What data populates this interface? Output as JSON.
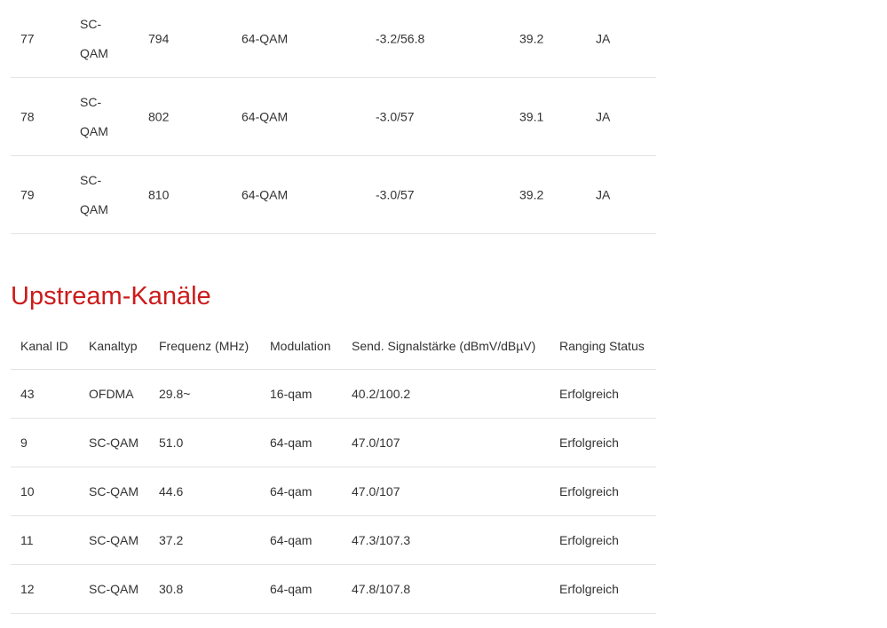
{
  "downstream": {
    "rows": [
      {
        "id": "77",
        "type_line1": "SC-",
        "type_line2": "QAM",
        "freq": "794",
        "modulation": "64-QAM",
        "power": "-3.2/56.8",
        "snr": "39.2",
        "locked": "JA"
      },
      {
        "id": "78",
        "type_line1": "SC-",
        "type_line2": "QAM",
        "freq": "802",
        "modulation": "64-QAM",
        "power": "-3.0/57",
        "snr": "39.1",
        "locked": "JA"
      },
      {
        "id": "79",
        "type_line1": "SC-",
        "type_line2": "QAM",
        "freq": "810",
        "modulation": "64-QAM",
        "power": "-3.0/57",
        "snr": "39.2",
        "locked": "JA"
      }
    ]
  },
  "upstream": {
    "title": "Upstream-Kanäle",
    "headers": {
      "id": "Kanal ID",
      "type": "Kanaltyp",
      "freq": "Frequenz (MHz)",
      "modulation": "Modulation",
      "power": "Send. Signalstärke (dBmV/dBµV)",
      "ranging": "Ranging Status"
    },
    "rows": [
      {
        "id": "43",
        "type": "OFDMA",
        "freq": "29.8~",
        "modulation": "16-qam",
        "power": "40.2/100.2",
        "ranging": "Erfolgreich"
      },
      {
        "id": "9",
        "type": "SC-QAM",
        "freq": "51.0",
        "modulation": "64-qam",
        "power": "47.0/107",
        "ranging": "Erfolgreich"
      },
      {
        "id": "10",
        "type": "SC-QAM",
        "freq": "44.6",
        "modulation": "64-qam",
        "power": "47.0/107",
        "ranging": "Erfolgreich"
      },
      {
        "id": "11",
        "type": "SC-QAM",
        "freq": "37.2",
        "modulation": "64-qam",
        "power": "47.3/107.3",
        "ranging": "Erfolgreich"
      },
      {
        "id": "12",
        "type": "SC-QAM",
        "freq": "30.8",
        "modulation": "64-qam",
        "power": "47.8/107.8",
        "ranging": "Erfolgreich"
      }
    ]
  },
  "colors": {
    "heading": "#cc1b1b",
    "text": "#333333",
    "divider": "#e3e3e3"
  }
}
